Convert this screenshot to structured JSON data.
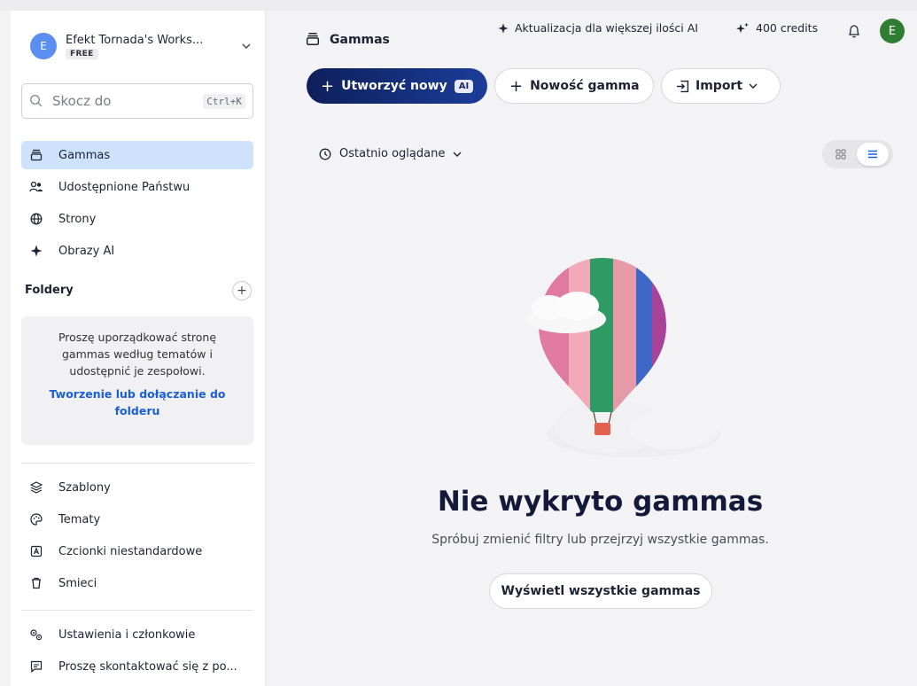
{
  "workspace": {
    "avatar_letter": "E",
    "name": "Efekt Tornada's Works...",
    "plan_badge": "FREE",
    "chevron_icon": "chevron-down-icon"
  },
  "search": {
    "placeholder": "Skocz do",
    "shortcut": "Ctrl+K",
    "icon": "search-icon"
  },
  "nav": {
    "gammas": "Gammas",
    "shared": "Udostępnione Państwu",
    "sites": "Strony",
    "ai_images": "Obrazy AI"
  },
  "folders": {
    "heading": "Foldery",
    "description": "Proszę uporządkować stronę gammas według tematów i udostępnić je zespołowi.",
    "link": "Tworzenie lub dołączanie do folderu"
  },
  "nav_bottom": {
    "templates": "Szablony",
    "themes": "Tematy",
    "fonts": "Czcionki niestandardowe",
    "trash": "Smieci",
    "settings": "Ustawienia i członkowie",
    "contact": "Proszę skontaktować się z po..."
  },
  "header": {
    "title": "Gammas",
    "upgrade": "Aktualizacja dla większej ilości AI",
    "credits": "400 credits",
    "user_letter": "E"
  },
  "actions": {
    "create_new": "Utworzyć nowy",
    "ai_badge": "AI",
    "new_gamma": "Nowość gamma",
    "import": "Import"
  },
  "sort": {
    "label": "Ostatnio oglądane"
  },
  "view": {
    "active": "list"
  },
  "empty": {
    "title": "Nie wykryto gammas",
    "subtitle": "Spróbuj zmienić filtry lub przejrzyj wszystkie gammas.",
    "button": "Wyświetl wszystkie gammas"
  },
  "colors": {
    "accent": "#1a5fd8",
    "active_nav_bg": "#cfe2fb",
    "primary_button": "#0e1f5a",
    "user_avatar": "#2e7d32",
    "workspace_avatar": "#5b8ef0"
  }
}
